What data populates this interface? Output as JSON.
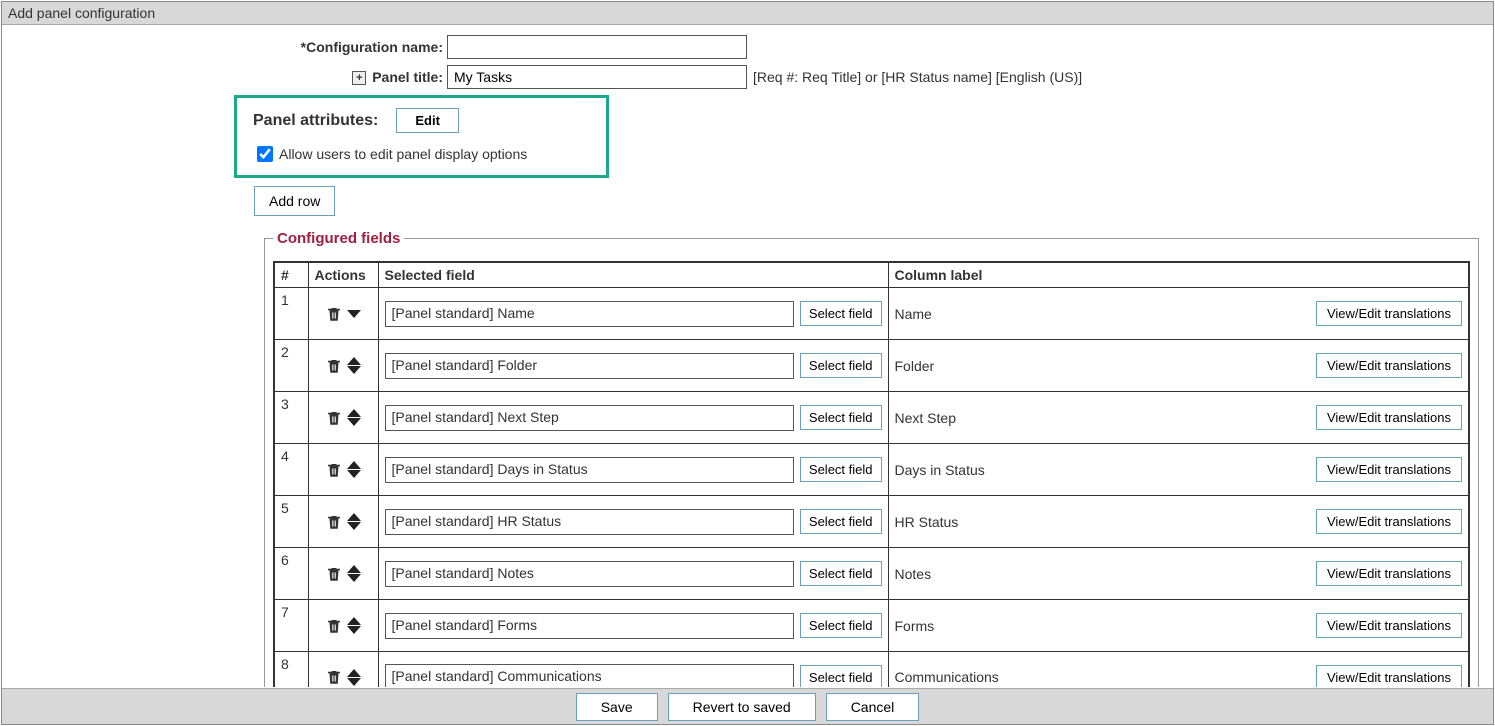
{
  "window_title": "Add panel configuration",
  "form": {
    "config_name_label": "*Configuration name:",
    "config_name_value": "",
    "panel_title_label": "Panel title:",
    "panel_title_value": "My Tasks",
    "panel_title_hint": "[Req #: Req Title] or [HR Status name] [English (US)]"
  },
  "panel_attributes": {
    "label": "Panel attributes:",
    "edit_button": "Edit",
    "allow_checkbox_label": "Allow users to edit panel display options",
    "allow_checked": true
  },
  "add_row_button": "Add row",
  "configured_fields": {
    "legend": "Configured fields",
    "headers": {
      "num": "#",
      "actions": "Actions",
      "selected": "Selected field",
      "label": "Column label"
    },
    "select_field_button": "Select field",
    "view_edit_button": "View/Edit translations",
    "rows": [
      {
        "num": "1",
        "selected": "[Panel standard] Name",
        "label": "Name",
        "up": false,
        "down": true
      },
      {
        "num": "2",
        "selected": "[Panel standard] Folder",
        "label": "Folder",
        "up": true,
        "down": true
      },
      {
        "num": "3",
        "selected": "[Panel standard] Next Step",
        "label": "Next Step",
        "up": true,
        "down": true
      },
      {
        "num": "4",
        "selected": "[Panel standard] Days in Status",
        "label": "Days in Status",
        "up": true,
        "down": true
      },
      {
        "num": "5",
        "selected": "[Panel standard] HR Status",
        "label": "HR Status",
        "up": true,
        "down": true
      },
      {
        "num": "6",
        "selected": "[Panel standard] Notes",
        "label": "Notes",
        "up": true,
        "down": true
      },
      {
        "num": "7",
        "selected": "[Panel standard] Forms",
        "label": "Forms",
        "up": true,
        "down": true
      },
      {
        "num": "8",
        "selected": "[Panel standard] Communications",
        "label": "Communications",
        "up": true,
        "down": true
      }
    ]
  },
  "footer": {
    "save": "Save",
    "revert": "Revert to saved",
    "cancel": "Cancel"
  }
}
